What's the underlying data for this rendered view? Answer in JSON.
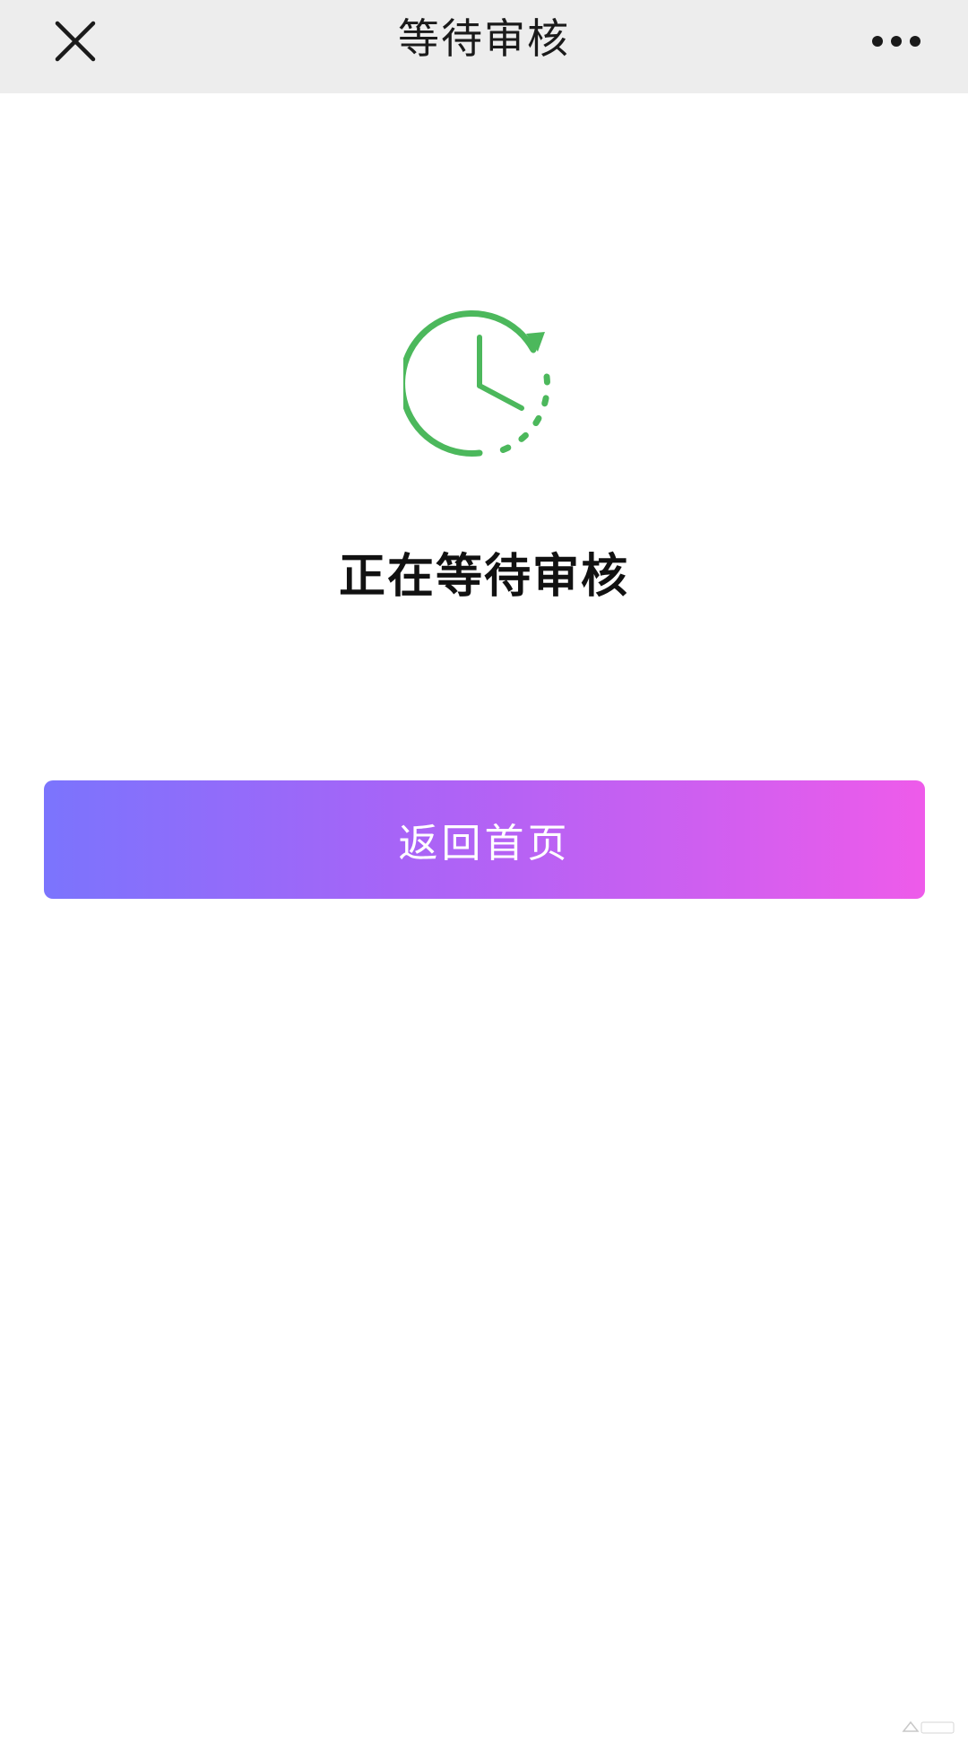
{
  "nav": {
    "title": "等待审核",
    "close_icon": "close-icon",
    "more_icon": "more-dots-icon"
  },
  "status": {
    "icon": "clock-pending-icon",
    "icon_color": "#4cb85c",
    "message": "正在等待审核"
  },
  "actions": {
    "home_label": "返回首页",
    "gradient_start": "#7b74fd",
    "gradient_end": "#ee5bea"
  },
  "watermark": {
    "icon": "watermark-icon"
  }
}
